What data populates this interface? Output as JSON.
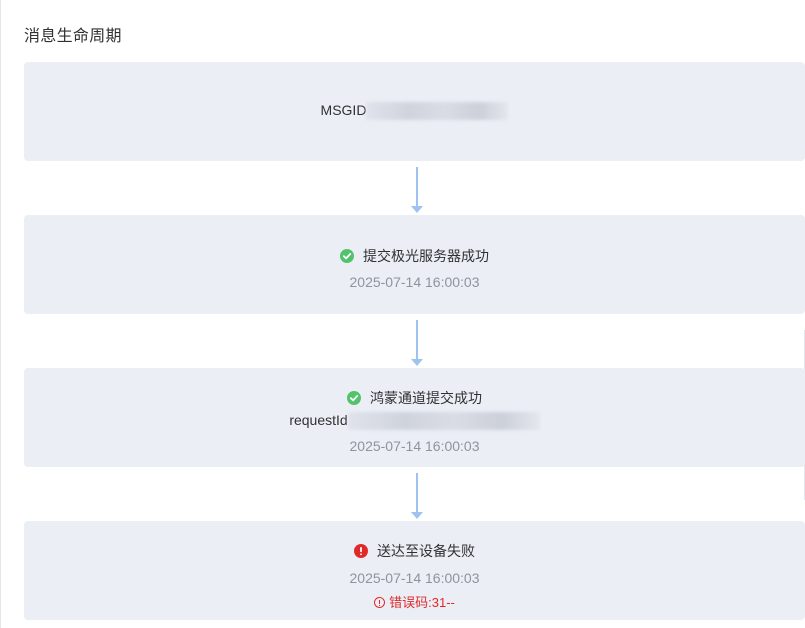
{
  "title": "消息生命周期",
  "msgid_label": "MSGID",
  "steps": [
    {
      "status": "提交极光服务器成功",
      "time": "2025-07-14 16:00:03"
    },
    {
      "status": "鸿蒙通道提交成功",
      "request_label": "requestId",
      "time": "2025-07-14 16:00:03"
    },
    {
      "status": "送达至设备失败",
      "time": "2025-07-14 16:00:03",
      "error": "错误码:31--"
    }
  ],
  "colors": {
    "success": "#52c26b",
    "error": "#e02a2a",
    "card": "#ebeef5",
    "connector": "#9ec3ef"
  },
  "icons": {
    "success": "check-circle-icon",
    "error": "exclamation-circle-icon"
  }
}
